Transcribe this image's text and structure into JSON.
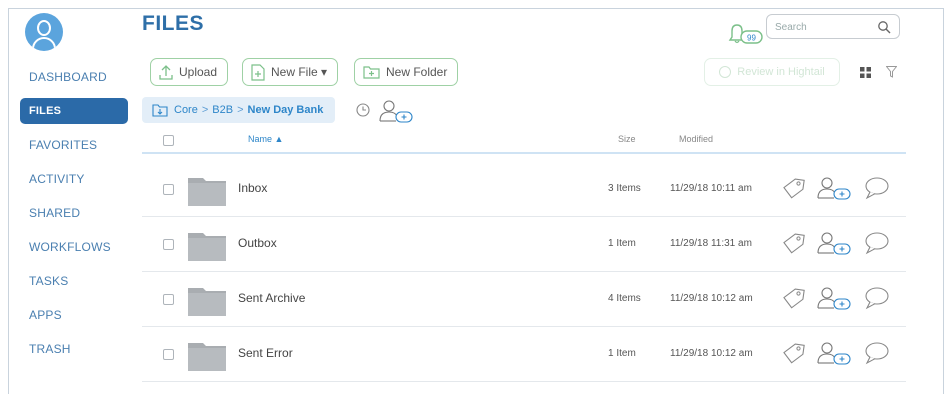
{
  "header": {
    "title": "FILES",
    "notification_count": "99"
  },
  "search": {
    "placeholder": "Search"
  },
  "sidebar": {
    "items": [
      {
        "label": "DASHBOARD"
      },
      {
        "label": "FILES"
      },
      {
        "label": "FAVORITES"
      },
      {
        "label": "ACTIVITY"
      },
      {
        "label": "SHARED"
      },
      {
        "label": "WORKFLOWS"
      },
      {
        "label": "TASKS"
      },
      {
        "label": "APPS"
      },
      {
        "label": "TRASH"
      }
    ],
    "active": "FILES"
  },
  "toolbar": {
    "upload_label": "Upload",
    "new_file_label": "New File ▾",
    "new_folder_label": "New Folder",
    "review_label": "Review in Hightail"
  },
  "breadcrumb": {
    "part1": "Core",
    "part2": "B2B",
    "part3": "New Day Bank",
    "separator": ">"
  },
  "table": {
    "columns": {
      "name": "Name ▲",
      "size": "Size",
      "modified": "Modified"
    },
    "rows": [
      {
        "name": "Inbox",
        "size": "3 Items",
        "modified": "11/29/18 10:11 am"
      },
      {
        "name": "Outbox",
        "size": "1 Item",
        "modified": "11/29/18 11:31 am"
      },
      {
        "name": "Sent Archive",
        "size": "4 Items",
        "modified": "11/29/18 10:12 am"
      },
      {
        "name": "Sent Error",
        "size": "1 Item",
        "modified": "11/29/18 10:12 am"
      }
    ]
  },
  "colors": {
    "accent": "#2e6fa8",
    "active_nav": "#2b6aa8",
    "button_border": "#9fd1a5",
    "folder": "#a9adb1",
    "icon_green": "#7cc08a"
  },
  "icons": [
    "avatar",
    "bell-icon",
    "search-icon",
    "upload-icon",
    "new-file-icon",
    "new-folder-icon",
    "grid-view-icon",
    "filter-icon",
    "folder-icon",
    "clock-icon",
    "share-user-icon",
    "tag-icon",
    "comment-icon"
  ]
}
